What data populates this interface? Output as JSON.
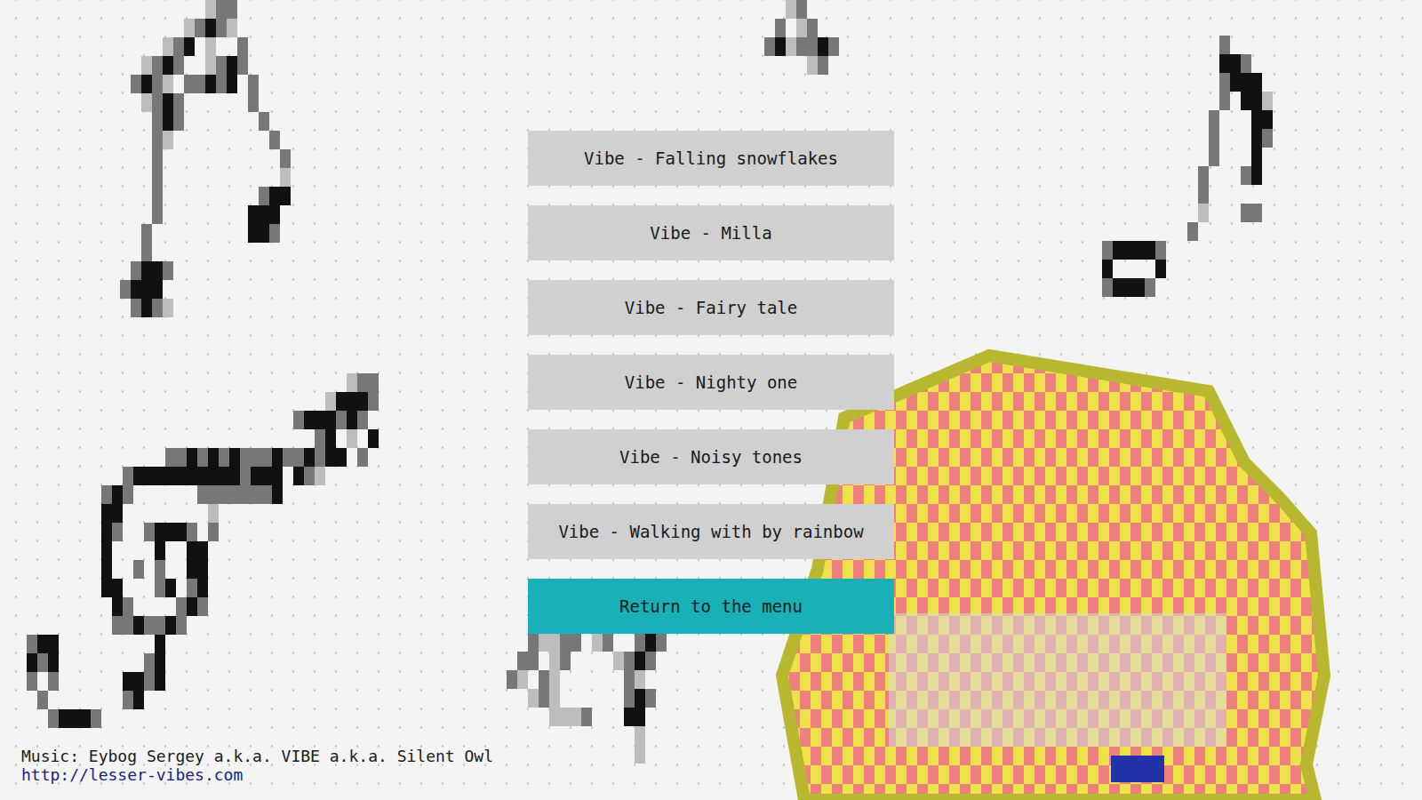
{
  "menu": {
    "items": [
      {
        "label": "Vibe - Falling snowflakes",
        "selected": false
      },
      {
        "label": "Vibe - Milla",
        "selected": false
      },
      {
        "label": "Vibe - Fairy tale",
        "selected": false
      },
      {
        "label": "Vibe - Nighty one",
        "selected": false
      },
      {
        "label": "Vibe - Noisy tones",
        "selected": false
      },
      {
        "label": "Vibe - Walking with by rainbow",
        "selected": false
      },
      {
        "label": "Return to the menu",
        "selected": true
      }
    ]
  },
  "credits": {
    "text": "Music: Eybog Sergey a.k.a. VIBE a.k.a. Silent Owl",
    "link": "http://lesser-vibes.com"
  }
}
